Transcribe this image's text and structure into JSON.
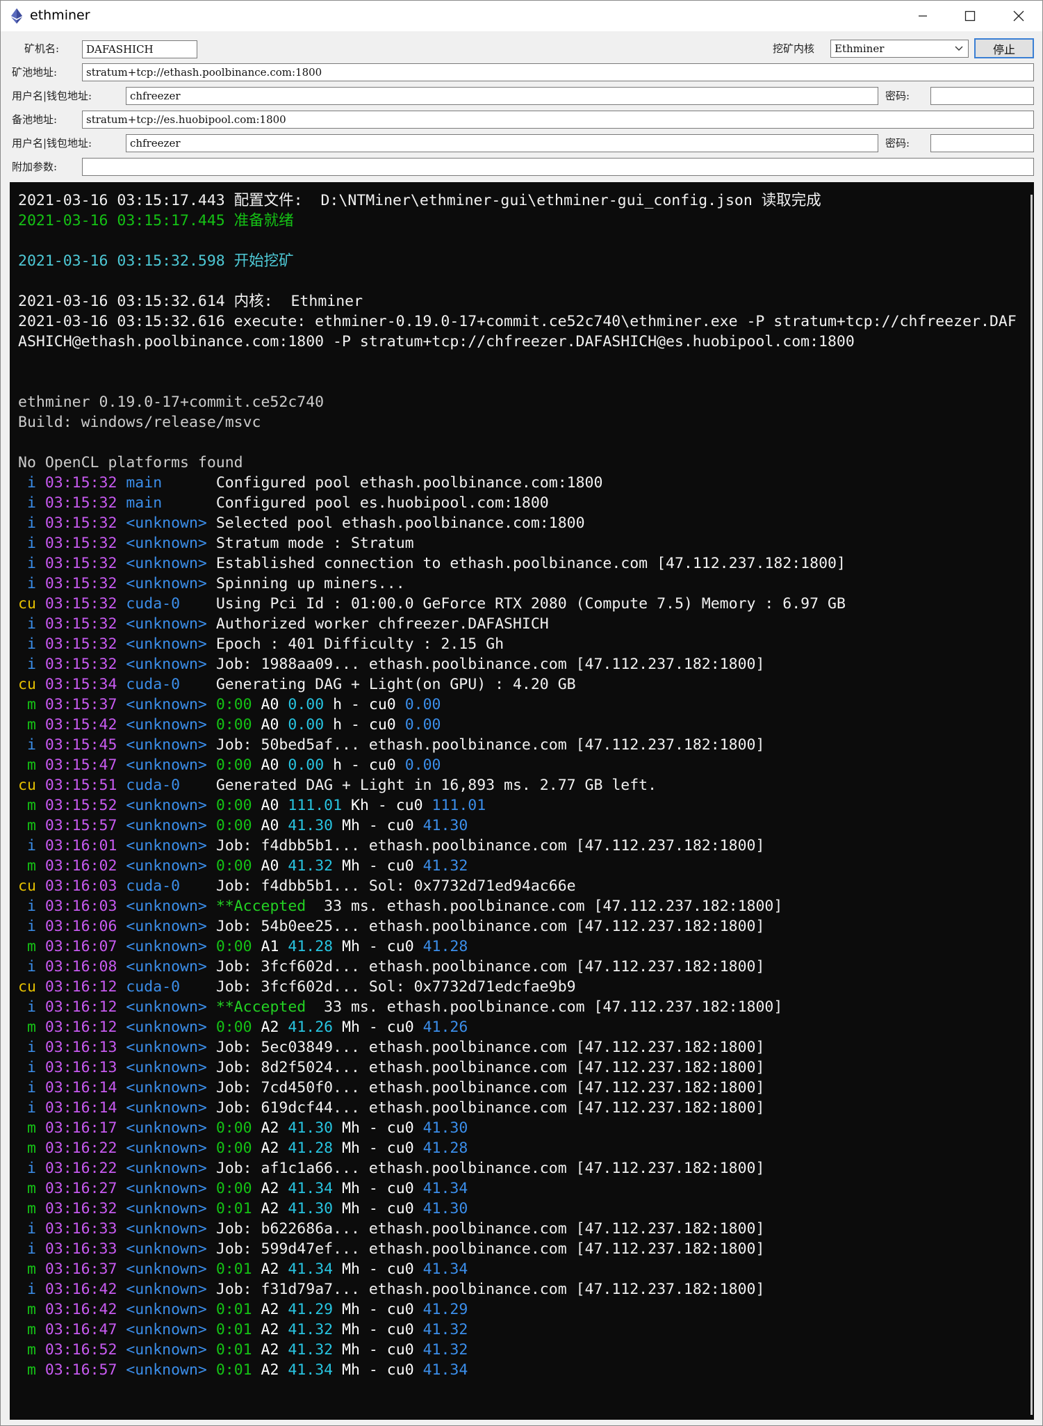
{
  "window": {
    "title": "ethminer"
  },
  "form": {
    "miner_label": "矿机名:",
    "miner_value": "DAFASHICH",
    "kernel_label": "挖矿内核",
    "kernel_value": "Ethminer",
    "stop_label": "停止",
    "pool_label": "矿池地址:",
    "pool_value": "stratum+tcp://ethash.poolbinance.com:1800",
    "user_label": "用户名|钱包地址:",
    "user_value": "chfreezer",
    "password_label": "密码:",
    "password_value": "",
    "backup_pool_label": "备池地址:",
    "backup_pool_value": "stratum+tcp://es.huobipool.com:1800",
    "backup_user_label": "用户名|钱包地址:",
    "backup_user_value": "chfreezer",
    "backup_password_label": "密码:",
    "backup_password_value": "",
    "extra_label": "附加参数:",
    "extra_value": ""
  },
  "console": {
    "header_lines": [
      {
        "text": "2021-03-16 03:15:17.443 配置文件:  D:\\NTMiner\\ethminer-gui\\ethminer-gui_config.json 读取完成",
        "color": "white"
      },
      {
        "text": "2021-03-16 03:15:17.445 准备就绪",
        "color": "green"
      },
      {
        "text": "",
        "color": "white"
      },
      {
        "text": "2021-03-16 03:15:32.598 开始挖矿",
        "color": "cyan"
      },
      {
        "text": "",
        "color": "white"
      },
      {
        "text": "2021-03-16 03:15:32.614 内核:  Ethminer",
        "color": "white"
      },
      {
        "text": "2021-03-16 03:15:32.616 execute: ethminer-0.19.0-17+commit.ce52c740\\ethminer.exe -P stratum+tcp://chfreezer.DAFASHICH@ethash.poolbinance.com:1800 -P stratum+tcp://chfreezer.DAFASHICH@es.huobipool.com:1800",
        "color": "white",
        "wrap": true
      },
      {
        "text": "",
        "color": "white"
      },
      {
        "text": "",
        "color": "white"
      },
      {
        "text": "ethminer 0.19.0-17+commit.ce52c740",
        "color": "grey"
      },
      {
        "text": "Build: windows/release/msvc",
        "color": "grey"
      },
      {
        "text": "",
        "color": "white"
      },
      {
        "text": "No OpenCL platforms found",
        "color": "grey"
      }
    ],
    "log_lines": [
      {
        "lvl": " i",
        "time": "03:15:32",
        "src": "main     ",
        "msg": "Configured pool ethash.poolbinance.com:1800"
      },
      {
        "lvl": " i",
        "time": "03:15:32",
        "src": "main     ",
        "msg": "Configured pool es.huobipool.com:1800"
      },
      {
        "lvl": " i",
        "time": "03:15:32",
        "src": "<unknown>",
        "msg": "Selected pool ethash.poolbinance.com:1800"
      },
      {
        "lvl": " i",
        "time": "03:15:32",
        "src": "<unknown>",
        "msg": "Stratum mode : Stratum"
      },
      {
        "lvl": " i",
        "time": "03:15:32",
        "src": "<unknown>",
        "msg": "Established connection to ethash.poolbinance.com [47.112.237.182:1800]"
      },
      {
        "lvl": " i",
        "time": "03:15:32",
        "src": "<unknown>",
        "msg": "Spinning up miners..."
      },
      {
        "lvl": "cu",
        "time": "03:15:32",
        "src": "cuda-0   ",
        "msg": "Using Pci Id : 01:00.0 GeForce RTX 2080 (Compute 7.5) Memory : 6.97 GB"
      },
      {
        "lvl": " i",
        "time": "03:15:32",
        "src": "<unknown>",
        "msg": "Authorized worker chfreezer.DAFASHICH"
      },
      {
        "lvl": " i",
        "time": "03:15:32",
        "src": "<unknown>",
        "msg": "Epoch : 401 Difficulty : 2.15 Gh"
      },
      {
        "lvl": " i",
        "time": "03:15:32",
        "src": "<unknown>",
        "msg": "Job: 1988aa09... ethash.poolbinance.com [47.112.237.182:1800]"
      },
      {
        "lvl": "cu",
        "time": "03:15:34",
        "src": "cuda-0   ",
        "msg": "Generating DAG + Light(on GPU) : 4.20 GB"
      },
      {
        "lvl": " m",
        "time": "03:15:37",
        "src": "<unknown>",
        "up": "0:00",
        "acc": "A0",
        "rate": "0.00",
        "unit": "h",
        "cu": "0.00"
      },
      {
        "lvl": " m",
        "time": "03:15:42",
        "src": "<unknown>",
        "up": "0:00",
        "acc": "A0",
        "rate": "0.00",
        "unit": "h",
        "cu": "0.00"
      },
      {
        "lvl": " i",
        "time": "03:15:45",
        "src": "<unknown>",
        "msg": "Job: 50bed5af... ethash.poolbinance.com [47.112.237.182:1800]"
      },
      {
        "lvl": " m",
        "time": "03:15:47",
        "src": "<unknown>",
        "up": "0:00",
        "acc": "A0",
        "rate": "0.00",
        "unit": "h",
        "cu": "0.00"
      },
      {
        "lvl": "cu",
        "time": "03:15:51",
        "src": "cuda-0   ",
        "msg": "Generated DAG + Light in 16,893 ms. 2.77 GB left."
      },
      {
        "lvl": " m",
        "time": "03:15:52",
        "src": "<unknown>",
        "up": "0:00",
        "acc": "A0",
        "rate": "111.01",
        "unit": "Kh",
        "cu": "111.01"
      },
      {
        "lvl": " m",
        "time": "03:15:57",
        "src": "<unknown>",
        "up": "0:00",
        "acc": "A0",
        "rate": "41.30",
        "unit": "Mh",
        "cu": "41.30"
      },
      {
        "lvl": " i",
        "time": "03:16:01",
        "src": "<unknown>",
        "msg": "Job: f4dbb5b1... ethash.poolbinance.com [47.112.237.182:1800]"
      },
      {
        "lvl": " m",
        "time": "03:16:02",
        "src": "<unknown>",
        "up": "0:00",
        "acc": "A0",
        "rate": "41.32",
        "unit": "Mh",
        "cu": "41.32"
      },
      {
        "lvl": "cu",
        "time": "03:16:03",
        "src": "cuda-0   ",
        "msg": "Job: f4dbb5b1... Sol: 0x7732d71ed94ac66e"
      },
      {
        "lvl": " i",
        "time": "03:16:03",
        "src": "<unknown>",
        "acc_msg": "**Accepted",
        "msg": "  33 ms. ethash.poolbinance.com [47.112.237.182:1800]"
      },
      {
        "lvl": " i",
        "time": "03:16:06",
        "src": "<unknown>",
        "msg": "Job: 54b0ee25... ethash.poolbinance.com [47.112.237.182:1800]"
      },
      {
        "lvl": " m",
        "time": "03:16:07",
        "src": "<unknown>",
        "up": "0:00",
        "acc": "A1",
        "rate": "41.28",
        "unit": "Mh",
        "cu": "41.28"
      },
      {
        "lvl": " i",
        "time": "03:16:08",
        "src": "<unknown>",
        "msg": "Job: 3fcf602d... ethash.poolbinance.com [47.112.237.182:1800]"
      },
      {
        "lvl": "cu",
        "time": "03:16:12",
        "src": "cuda-0   ",
        "msg": "Job: 3fcf602d... Sol: 0x7732d71edcfae9b9"
      },
      {
        "lvl": " i",
        "time": "03:16:12",
        "src": "<unknown>",
        "acc_msg": "**Accepted",
        "msg": "  33 ms. ethash.poolbinance.com [47.112.237.182:1800]"
      },
      {
        "lvl": " m",
        "time": "03:16:12",
        "src": "<unknown>",
        "up": "0:00",
        "acc": "A2",
        "rate": "41.26",
        "unit": "Mh",
        "cu": "41.26"
      },
      {
        "lvl": " i",
        "time": "03:16:13",
        "src": "<unknown>",
        "msg": "Job: 5ec03849... ethash.poolbinance.com [47.112.237.182:1800]"
      },
      {
        "lvl": " i",
        "time": "03:16:13",
        "src": "<unknown>",
        "msg": "Job: 8d2f5024... ethash.poolbinance.com [47.112.237.182:1800]"
      },
      {
        "lvl": " i",
        "time": "03:16:14",
        "src": "<unknown>",
        "msg": "Job: 7cd450f0... ethash.poolbinance.com [47.112.237.182:1800]"
      },
      {
        "lvl": " i",
        "time": "03:16:14",
        "src": "<unknown>",
        "msg": "Job: 619dcf44... ethash.poolbinance.com [47.112.237.182:1800]"
      },
      {
        "lvl": " m",
        "time": "03:16:17",
        "src": "<unknown>",
        "up": "0:00",
        "acc": "A2",
        "rate": "41.30",
        "unit": "Mh",
        "cu": "41.30"
      },
      {
        "lvl": " m",
        "time": "03:16:22",
        "src": "<unknown>",
        "up": "0:00",
        "acc": "A2",
        "rate": "41.28",
        "unit": "Mh",
        "cu": "41.28"
      },
      {
        "lvl": " i",
        "time": "03:16:22",
        "src": "<unknown>",
        "msg": "Job: af1c1a66... ethash.poolbinance.com [47.112.237.182:1800]"
      },
      {
        "lvl": " m",
        "time": "03:16:27",
        "src": "<unknown>",
        "up": "0:00",
        "acc": "A2",
        "rate": "41.34",
        "unit": "Mh",
        "cu": "41.34"
      },
      {
        "lvl": " m",
        "time": "03:16:32",
        "src": "<unknown>",
        "up": "0:01",
        "acc": "A2",
        "rate": "41.30",
        "unit": "Mh",
        "cu": "41.30"
      },
      {
        "lvl": " i",
        "time": "03:16:33",
        "src": "<unknown>",
        "msg": "Job: b622686a... ethash.poolbinance.com [47.112.237.182:1800]"
      },
      {
        "lvl": " i",
        "time": "03:16:33",
        "src": "<unknown>",
        "msg": "Job: 599d47ef... ethash.poolbinance.com [47.112.237.182:1800]"
      },
      {
        "lvl": " m",
        "time": "03:16:37",
        "src": "<unknown>",
        "up": "0:01",
        "acc": "A2",
        "rate": "41.34",
        "unit": "Mh",
        "cu": "41.34"
      },
      {
        "lvl": " i",
        "time": "03:16:42",
        "src": "<unknown>",
        "msg": "Job: f31d79a7... ethash.poolbinance.com [47.112.237.182:1800]"
      },
      {
        "lvl": " m",
        "time": "03:16:42",
        "src": "<unknown>",
        "up": "0:01",
        "acc": "A2",
        "rate": "41.29",
        "unit": "Mh",
        "cu": "41.29"
      },
      {
        "lvl": " m",
        "time": "03:16:47",
        "src": "<unknown>",
        "up": "0:01",
        "acc": "A2",
        "rate": "41.32",
        "unit": "Mh",
        "cu": "41.32"
      },
      {
        "lvl": " m",
        "time": "03:16:52",
        "src": "<unknown>",
        "up": "0:01",
        "acc": "A2",
        "rate": "41.32",
        "unit": "Mh",
        "cu": "41.32"
      },
      {
        "lvl": " m",
        "time": "03:16:57",
        "src": "<unknown>",
        "up": "0:01",
        "acc": "A2",
        "rate": "41.34",
        "unit": "Mh",
        "cu": "41.34"
      }
    ]
  }
}
